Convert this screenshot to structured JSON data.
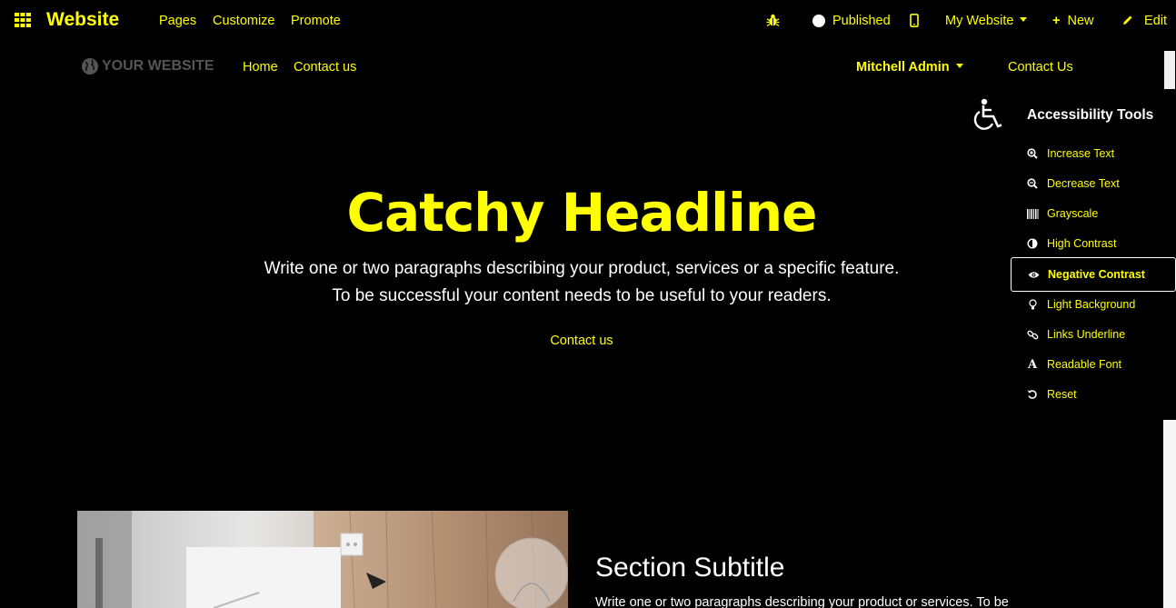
{
  "topbar": {
    "brand": "Website",
    "menus": [
      "Pages",
      "Customize",
      "Promote"
    ],
    "published_label": "Published",
    "my_website_label": "My Website",
    "new_label": "New",
    "edit_label": "Edit"
  },
  "header": {
    "logo_text": "YOUR WEBSITE",
    "nav": [
      "Home",
      "Contact us"
    ],
    "user_menu": "Mitchell Admin",
    "contact_button": "Contact Us"
  },
  "hero": {
    "headline": "Catchy Headline",
    "lead_line1": "Write one or two paragraphs describing your product, services or a specific feature.",
    "lead_line2": "To be successful your content needs to be useful to your readers.",
    "cta": "Contact us"
  },
  "section": {
    "title": "Section Subtitle",
    "text": "Write one or two paragraphs describing your product or services. To be"
  },
  "accessibility": {
    "title": "Accessibility Tools",
    "items": [
      {
        "label": "Increase Text",
        "icon": "zoom-in-icon"
      },
      {
        "label": "Decrease Text",
        "icon": "zoom-out-icon"
      },
      {
        "label": "Grayscale",
        "icon": "barcode-icon"
      },
      {
        "label": "High Contrast",
        "icon": "contrast-icon"
      },
      {
        "label": "Negative Contrast",
        "icon": "eye-icon",
        "active": true
      },
      {
        "label": "Light Background",
        "icon": "lightbulb-icon"
      },
      {
        "label": "Links Underline",
        "icon": "link-icon"
      },
      {
        "label": "Readable Font",
        "icon": "font-icon"
      },
      {
        "label": "Reset",
        "icon": "reset-icon"
      }
    ]
  },
  "colors": {
    "background": "#000000",
    "accent": "#ffff00",
    "text": "#ffffff"
  }
}
